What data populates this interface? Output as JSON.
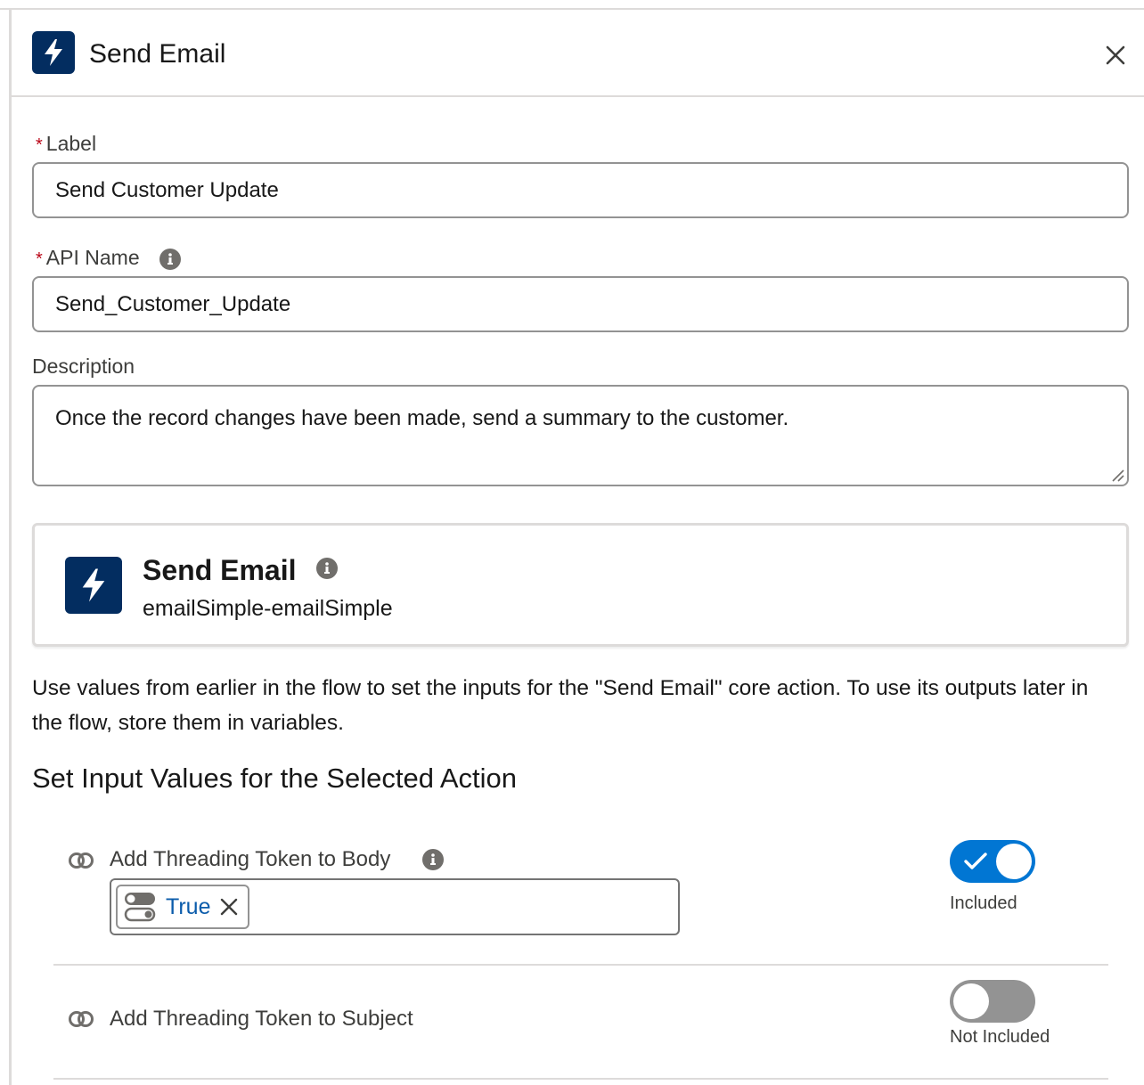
{
  "header": {
    "title": "Send Email",
    "icon": "lightning-bolt-icon",
    "close_icon": "close-icon"
  },
  "form": {
    "label": {
      "required_marker": "*",
      "label": "Label",
      "value": "Send Customer Update"
    },
    "api_name": {
      "required_marker": "*",
      "label": "API Name",
      "value": "Send_Customer_Update"
    },
    "description": {
      "label": "Description",
      "value": "Once the record changes have been made, send a summary to the customer."
    }
  },
  "action_card": {
    "title": "Send Email",
    "subtitle": "emailSimple-emailSimple",
    "icon": "lightning-bolt-icon"
  },
  "help_text": "Use values from earlier in the flow to set the inputs for the \"Send Email\" core action. To use its outputs later in the flow, store them in variables.",
  "section_heading": "Set Input Values for the Selected Action",
  "inputs": [
    {
      "label": "Add Threading Token to Body",
      "value": "True",
      "value_type_icon": "boolean-toggle-icon",
      "included": true,
      "status": "Included"
    },
    {
      "label": "Add Threading Token to Subject",
      "included": false,
      "status": "Not Included"
    }
  ],
  "colors": {
    "brand_dark": "#032d60",
    "toggle_on": "#0176d3",
    "toggle_off": "#939393",
    "required": "#ba0517",
    "value_link": "#0b5cab"
  }
}
